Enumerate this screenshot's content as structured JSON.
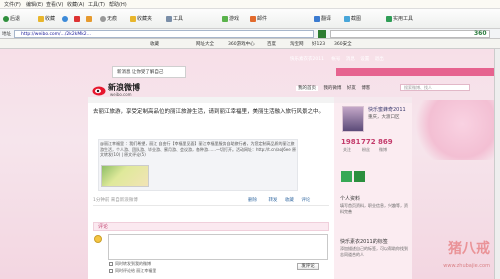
{
  "menu": [
    "文件(F)",
    "编辑(E)",
    "查看(V)",
    "收藏(A)",
    "工具(T)",
    "帮助(H)"
  ],
  "toolbar": {
    "back": "后退",
    "favorites": "收藏",
    "no_image": "无痕",
    "collect": "收藏夹",
    "tools": "工具",
    "game": "游戏",
    "mail": "邮件",
    "translate": "翻译",
    "screenshot": "截图",
    "practical_tools": "实用工具"
  },
  "address": {
    "label": "地址",
    "url": "http://weibo.com/.../2k2kMk2..."
  },
  "fav_bar": {
    "brand": "360",
    "items": [
      "收藏",
      "网址大全",
      "360游戏中心",
      "百度",
      "淘宝网",
      "好123",
      "360安全"
    ]
  },
  "bubble": {
    "text": "新消息 让你受了解自己"
  },
  "site_nav": {
    "links": [
      "快乐素衣衣2011",
      "帐号",
      "消息",
      "设置",
      "退出"
    ]
  },
  "logo": {
    "name": "新浪微博",
    "domain": "weibo.com"
  },
  "search": {
    "placeholder": "搜索微博、找人"
  },
  "nav": [
    "我的首页",
    "我的微博",
    "好友",
    "博客"
  ],
  "post": {
    "text": "去丽江旅游，享受定制高品位的丽江旅游生活，请到丽江幸福里，美丽生活融入旅行风景之中。",
    "repost_text": "@丽江幸福里 ：我们希望，丽江 自由行【幸福里见面】丽江幸福里服务自助旅行者，为您定制高品质的丽江旅游生活，个人游、团队游、毕业游、蜜月游、会议游，各种游……一切打开。活动网址：http://t.cn/aoJ6ee 原文转发(10) | 原文评论(5)",
    "time": "1分钟前  来自新浪微博",
    "actions": [
      "删除",
      "转发",
      "收藏",
      "评论"
    ]
  },
  "comment": {
    "header": "评论",
    "checkbox_label": "同时转发到我的微博",
    "checkbox2_label": "同时评论给 丽江幸福里",
    "send": "发评论"
  },
  "profile": {
    "name": "快乐蜜蜂奇2011",
    "location": "重庆，大渡口区",
    "stats": [
      {
        "num": "1981",
        "label": "关注"
      },
      {
        "num": "772",
        "label": "粉丝"
      },
      {
        "num": "869",
        "label": "微博"
      }
    ],
    "section1_title": "个人资料",
    "section1_text": "填写首页资料，职业信息，兴趣等，资料完善",
    "section2_title": "快乐素衣2011的标签",
    "section2_text": "添加描述自己的标签，可以帮助你找到志同道合的人"
  },
  "watermark": {
    "text": "猪八戒",
    "sub": "www.zhubajie.com"
  },
  "colors": {
    "accent": "#e6638f",
    "link": "#3a6ea5",
    "bg": "#f6e3ea"
  }
}
